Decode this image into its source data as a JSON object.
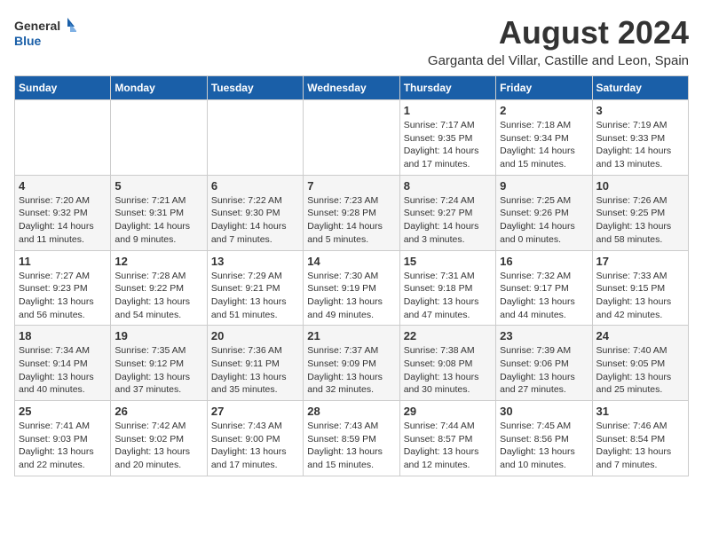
{
  "header": {
    "logo_line1": "General",
    "logo_line2": "Blue",
    "title": "August 2024",
    "subtitle": "Garganta del Villar, Castille and Leon, Spain"
  },
  "weekdays": [
    "Sunday",
    "Monday",
    "Tuesday",
    "Wednesday",
    "Thursday",
    "Friday",
    "Saturday"
  ],
  "weeks": [
    [
      {
        "day": "",
        "info": ""
      },
      {
        "day": "",
        "info": ""
      },
      {
        "day": "",
        "info": ""
      },
      {
        "day": "",
        "info": ""
      },
      {
        "day": "1",
        "info": "Sunrise: 7:17 AM\nSunset: 9:35 PM\nDaylight: 14 hours\nand 17 minutes."
      },
      {
        "day": "2",
        "info": "Sunrise: 7:18 AM\nSunset: 9:34 PM\nDaylight: 14 hours\nand 15 minutes."
      },
      {
        "day": "3",
        "info": "Sunrise: 7:19 AM\nSunset: 9:33 PM\nDaylight: 14 hours\nand 13 minutes."
      }
    ],
    [
      {
        "day": "4",
        "info": "Sunrise: 7:20 AM\nSunset: 9:32 PM\nDaylight: 14 hours\nand 11 minutes."
      },
      {
        "day": "5",
        "info": "Sunrise: 7:21 AM\nSunset: 9:31 PM\nDaylight: 14 hours\nand 9 minutes."
      },
      {
        "day": "6",
        "info": "Sunrise: 7:22 AM\nSunset: 9:30 PM\nDaylight: 14 hours\nand 7 minutes."
      },
      {
        "day": "7",
        "info": "Sunrise: 7:23 AM\nSunset: 9:28 PM\nDaylight: 14 hours\nand 5 minutes."
      },
      {
        "day": "8",
        "info": "Sunrise: 7:24 AM\nSunset: 9:27 PM\nDaylight: 14 hours\nand 3 minutes."
      },
      {
        "day": "9",
        "info": "Sunrise: 7:25 AM\nSunset: 9:26 PM\nDaylight: 14 hours\nand 0 minutes."
      },
      {
        "day": "10",
        "info": "Sunrise: 7:26 AM\nSunset: 9:25 PM\nDaylight: 13 hours\nand 58 minutes."
      }
    ],
    [
      {
        "day": "11",
        "info": "Sunrise: 7:27 AM\nSunset: 9:23 PM\nDaylight: 13 hours\nand 56 minutes."
      },
      {
        "day": "12",
        "info": "Sunrise: 7:28 AM\nSunset: 9:22 PM\nDaylight: 13 hours\nand 54 minutes."
      },
      {
        "day": "13",
        "info": "Sunrise: 7:29 AM\nSunset: 9:21 PM\nDaylight: 13 hours\nand 51 minutes."
      },
      {
        "day": "14",
        "info": "Sunrise: 7:30 AM\nSunset: 9:19 PM\nDaylight: 13 hours\nand 49 minutes."
      },
      {
        "day": "15",
        "info": "Sunrise: 7:31 AM\nSunset: 9:18 PM\nDaylight: 13 hours\nand 47 minutes."
      },
      {
        "day": "16",
        "info": "Sunrise: 7:32 AM\nSunset: 9:17 PM\nDaylight: 13 hours\nand 44 minutes."
      },
      {
        "day": "17",
        "info": "Sunrise: 7:33 AM\nSunset: 9:15 PM\nDaylight: 13 hours\nand 42 minutes."
      }
    ],
    [
      {
        "day": "18",
        "info": "Sunrise: 7:34 AM\nSunset: 9:14 PM\nDaylight: 13 hours\nand 40 minutes."
      },
      {
        "day": "19",
        "info": "Sunrise: 7:35 AM\nSunset: 9:12 PM\nDaylight: 13 hours\nand 37 minutes."
      },
      {
        "day": "20",
        "info": "Sunrise: 7:36 AM\nSunset: 9:11 PM\nDaylight: 13 hours\nand 35 minutes."
      },
      {
        "day": "21",
        "info": "Sunrise: 7:37 AM\nSunset: 9:09 PM\nDaylight: 13 hours\nand 32 minutes."
      },
      {
        "day": "22",
        "info": "Sunrise: 7:38 AM\nSunset: 9:08 PM\nDaylight: 13 hours\nand 30 minutes."
      },
      {
        "day": "23",
        "info": "Sunrise: 7:39 AM\nSunset: 9:06 PM\nDaylight: 13 hours\nand 27 minutes."
      },
      {
        "day": "24",
        "info": "Sunrise: 7:40 AM\nSunset: 9:05 PM\nDaylight: 13 hours\nand 25 minutes."
      }
    ],
    [
      {
        "day": "25",
        "info": "Sunrise: 7:41 AM\nSunset: 9:03 PM\nDaylight: 13 hours\nand 22 minutes."
      },
      {
        "day": "26",
        "info": "Sunrise: 7:42 AM\nSunset: 9:02 PM\nDaylight: 13 hours\nand 20 minutes."
      },
      {
        "day": "27",
        "info": "Sunrise: 7:43 AM\nSunset: 9:00 PM\nDaylight: 13 hours\nand 17 minutes."
      },
      {
        "day": "28",
        "info": "Sunrise: 7:43 AM\nSunset: 8:59 PM\nDaylight: 13 hours\nand 15 minutes."
      },
      {
        "day": "29",
        "info": "Sunrise: 7:44 AM\nSunset: 8:57 PM\nDaylight: 13 hours\nand 12 minutes."
      },
      {
        "day": "30",
        "info": "Sunrise: 7:45 AM\nSunset: 8:56 PM\nDaylight: 13 hours\nand 10 minutes."
      },
      {
        "day": "31",
        "info": "Sunrise: 7:46 AM\nSunset: 8:54 PM\nDaylight: 13 hours\nand 7 minutes."
      }
    ]
  ]
}
